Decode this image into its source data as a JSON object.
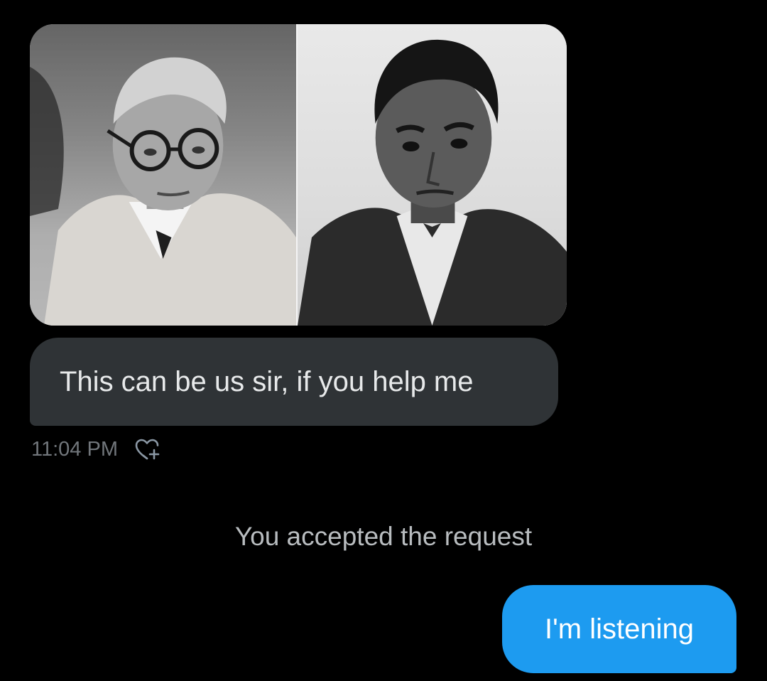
{
  "conversation": {
    "attachment": {
      "kind": "photo",
      "panels": [
        "portrait-left",
        "portrait-right"
      ]
    },
    "received_message": {
      "text": "This can be us sir, if you help me",
      "time": "11:04 PM",
      "reaction_icon": "add-reaction-heart-icon"
    },
    "system_note": "You accepted the request",
    "sent_message": {
      "text": "I'm listening"
    }
  },
  "colors": {
    "background": "#000000",
    "received_bubble": "#2f3336",
    "sent_bubble": "#1d9bf0",
    "timestamp": "#71767b",
    "system_text": "#b8bcbf"
  }
}
